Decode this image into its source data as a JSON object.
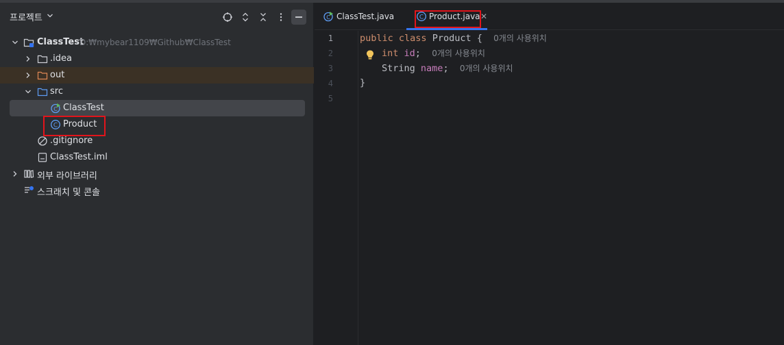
{
  "project_panel": {
    "title": "프로젝트",
    "tree": [
      {
        "label": "ClassTest",
        "path": "D:₩mybear1109₩Github₩ClassTest"
      },
      {
        "label": ".idea"
      },
      {
        "label": "out"
      },
      {
        "label": "src"
      },
      {
        "label": "ClassTest"
      },
      {
        "label": "Product"
      },
      {
        "label": ".gitignore"
      },
      {
        "label": "ClassTest.iml"
      },
      {
        "label": "외부 라이브러리"
      },
      {
        "label": "스크래치 및 콘솔"
      }
    ]
  },
  "editor": {
    "tabs": [
      {
        "label": "ClassTest.java"
      },
      {
        "label": "Product.java"
      }
    ],
    "line_numbers": [
      "1",
      "2",
      "3",
      "4",
      "5"
    ],
    "code": {
      "line1": {
        "kw1": "public",
        "kw2": "class",
        "name": "Product",
        "brace": "{",
        "hint": "0개의 사용위치"
      },
      "line2": {
        "type": "int",
        "field": "id",
        "semi": ";",
        "hint": "0개의 사용위치"
      },
      "line3": {
        "type": "String",
        "field": "name",
        "semi": ";",
        "hint": "0개의 사용위치"
      },
      "line4": {
        "brace": "}"
      }
    }
  },
  "colors": {
    "accent": "#3574f0",
    "highlight_box": "#e3141b",
    "keyword": "#cf8e6d",
    "field": "#c77dbb"
  }
}
